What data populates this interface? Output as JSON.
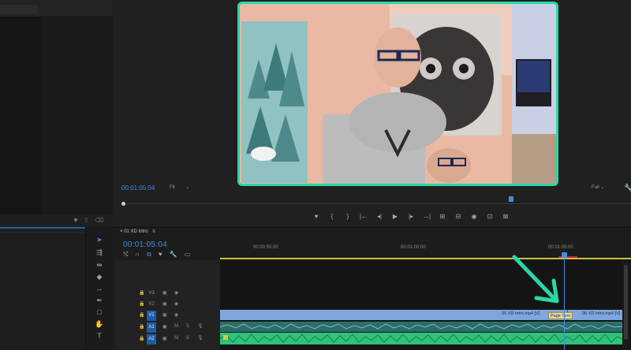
{
  "program_monitor": {
    "timecode": "00:01:05:04",
    "zoom": "Fit",
    "resolution": "Full",
    "transport_icons": [
      "marker-icon",
      "mark-in-icon",
      "mark-out-icon",
      "go-to-in-icon",
      "step-back-icon",
      "play-icon",
      "step-forward-icon",
      "go-to-out-icon",
      "lift-icon",
      "extract-icon",
      "export-frame-icon",
      "comparison-icon",
      "settings-icon"
    ],
    "transport_glyphs": [
      "♥",
      "{",
      "}",
      "|←",
      "◂|",
      "▶",
      "|▸",
      "→|",
      "⊞",
      "⊟",
      "◉",
      "⊡",
      "⊠"
    ]
  },
  "timeline": {
    "sequence_name": "01 XD Intro",
    "timecode": "00:01:05:04",
    "ruler_labels": [
      "00:00:55:00",
      "00:01:00:00",
      "00:01:05:00"
    ],
    "tracks": [
      {
        "name": "V3",
        "lock": "🔒",
        "sync": "▣",
        "vis": "◉"
      },
      {
        "name": "V2",
        "lock": "🔒",
        "sync": "▣",
        "vis": "◉"
      },
      {
        "name": "V1",
        "lock": "🔒",
        "sync": "▣",
        "vis": "◉",
        "selected": true
      },
      {
        "name": "A1",
        "lock": "🔒",
        "sync": "▣",
        "m": "M",
        "s": "S",
        "mic": "🎙",
        "selected": true
      },
      {
        "name": "A2",
        "lock": "🔒",
        "sync": "▣",
        "m": "M",
        "s": "S",
        "mic": "🎙",
        "selected": true
      }
    ],
    "clips": {
      "v1_a": "05 XD Intro.mp4 [V]",
      "v1_b": "06 XD Intro.mp4 [V]"
    },
    "tooltip": "Page Turn"
  },
  "colors": {
    "accent_blue": "#3f8fe0",
    "frame_highlight": "#29d7a8",
    "video_clip": "#7fa7dd",
    "audio_clip_a1": "#2c6d6a",
    "audio_clip_a2": "#2ec27a",
    "work_area_bar": "#c9c23b"
  }
}
